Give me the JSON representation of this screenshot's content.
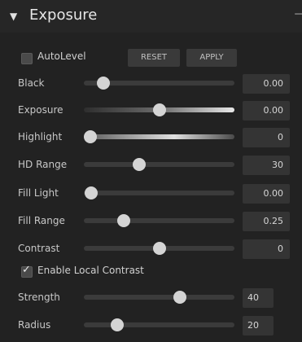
{
  "header": {
    "title": "Exposure",
    "collapse_glyph": "▼",
    "pin_glyph": "⊣"
  },
  "autolevel": {
    "label": "AutoLevel",
    "checked": false
  },
  "buttons": {
    "reset_label": "RESET",
    "apply_label": "APPLY"
  },
  "sliders": [
    {
      "label": "Black",
      "value": "0.00"
    },
    {
      "label": "Exposure",
      "value": "0.00"
    },
    {
      "label": "Highlight",
      "value": "0"
    },
    {
      "label": "HD Range",
      "value": "30"
    },
    {
      "label": "Fill Light",
      "value": "0.00"
    },
    {
      "label": "Fill Range",
      "value": "0.25"
    },
    {
      "label": "Contrast",
      "value": "0"
    }
  ],
  "local_contrast": {
    "label": "Enable Local Contrast",
    "checked": true,
    "strength": {
      "label": "Strength",
      "value": "40"
    },
    "radius": {
      "label": "Radius",
      "value": "20"
    }
  }
}
